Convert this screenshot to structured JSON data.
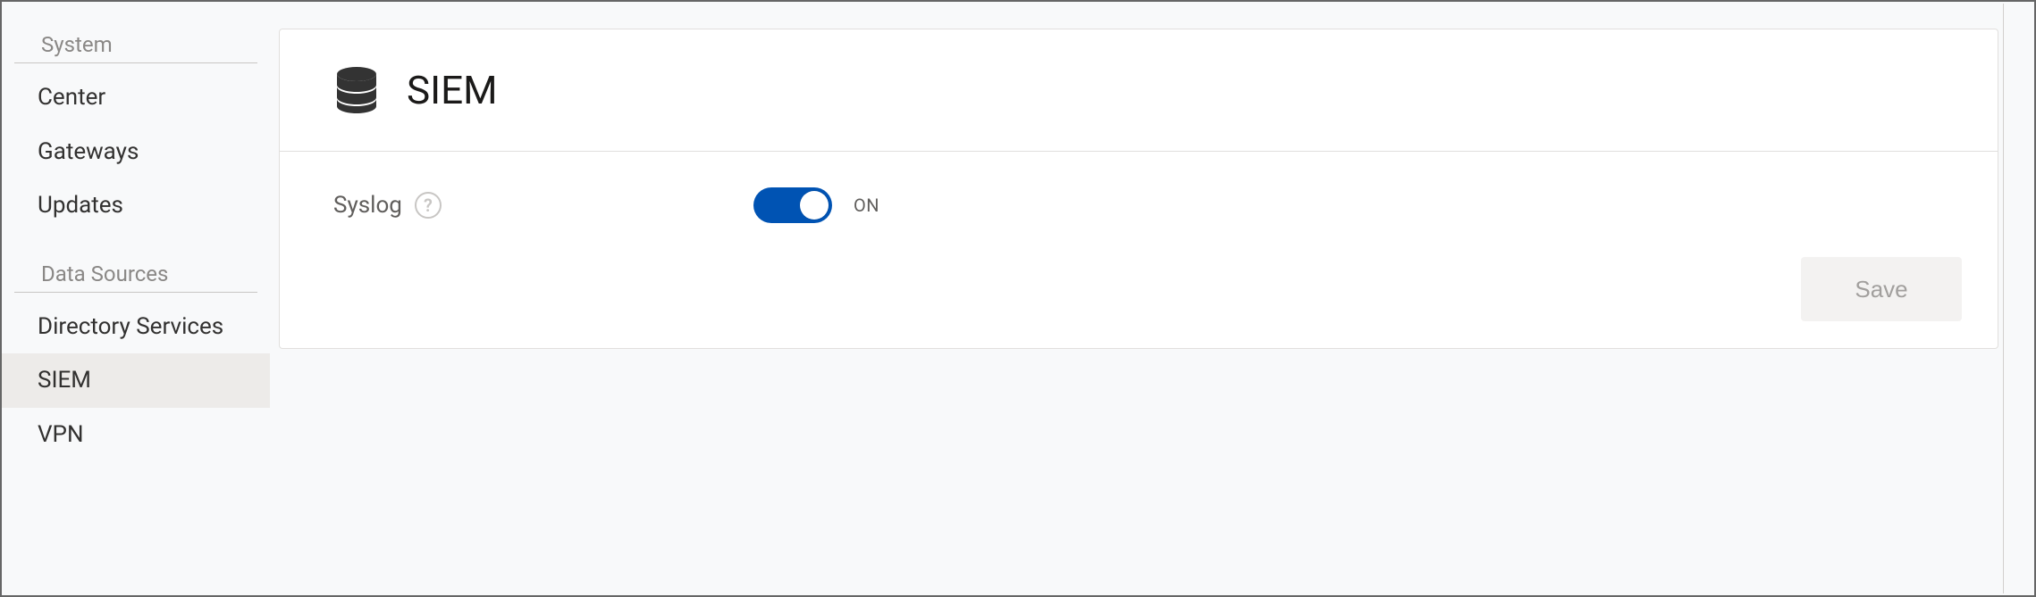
{
  "sidebar": {
    "groups": [
      {
        "title": "System",
        "items": [
          {
            "label": "Center"
          },
          {
            "label": "Gateways"
          },
          {
            "label": "Updates"
          }
        ]
      },
      {
        "title": "Data Sources",
        "items": [
          {
            "label": "Directory Services"
          },
          {
            "label": "SIEM",
            "active": true
          },
          {
            "label": "VPN"
          }
        ]
      }
    ]
  },
  "page": {
    "title": "SIEM",
    "icon": "database-icon"
  },
  "settings": {
    "syslog": {
      "label": "Syslog",
      "help_glyph": "?",
      "state_label": "ON",
      "on": true
    }
  },
  "actions": {
    "save_label": "Save",
    "save_enabled": false
  },
  "colors": {
    "accent": "#0053b3",
    "muted_text": "#8a8886",
    "border": "#e1dfdd"
  }
}
